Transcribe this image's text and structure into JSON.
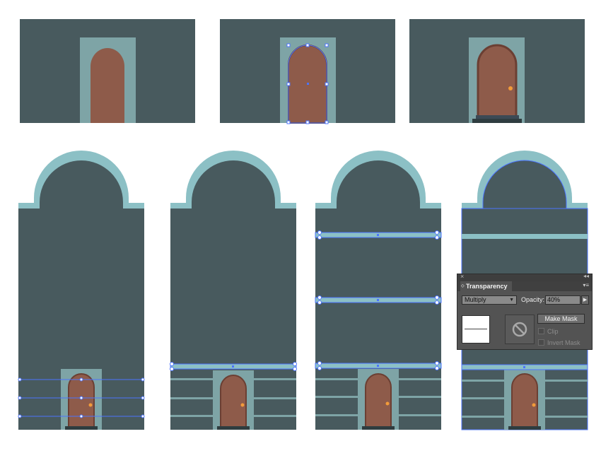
{
  "transparency_panel": {
    "close_glyph": "×",
    "collapse_glyph": "◂◂",
    "tab_arrows": "◇",
    "tab_title": "Transparency",
    "menu_glyph": "▾≡",
    "blend_mode": "Multiply",
    "blend_caret": "▼",
    "opacity_label": "Opacity:",
    "opacity_value": "40%",
    "opacity_button": "▶",
    "make_mask_label": "Make Mask",
    "clip_label": "Clip",
    "invert_mask_label": "Invert Mask",
    "no_mask_icon": "prohibited-icon"
  },
  "colors": {
    "wall": "#485a5e",
    "trim": "#8cc0c5",
    "door_frame": "#7ea4a6",
    "door": "#8e5b4a",
    "door_outline": "#6b3f33",
    "knob": "#f29b3a",
    "step": "#2f3d40",
    "selection": "#4c74ff"
  }
}
